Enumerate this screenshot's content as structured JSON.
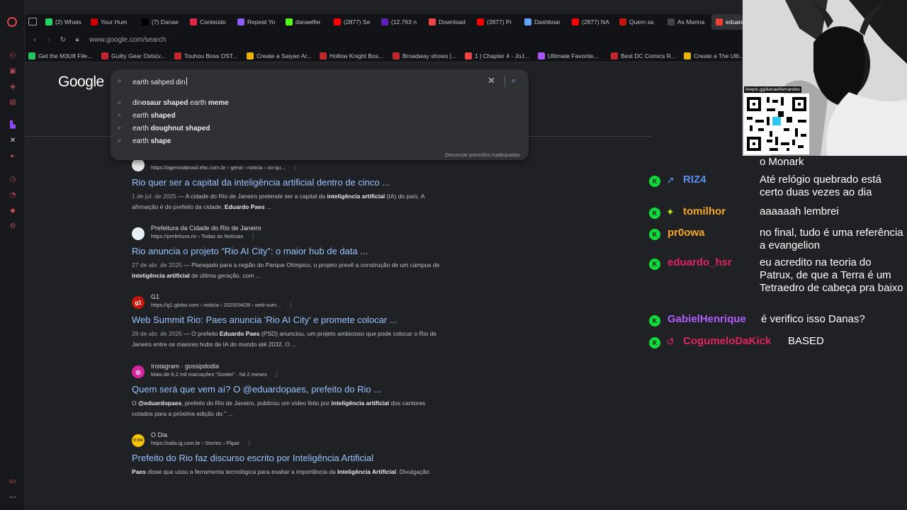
{
  "sidebar": {
    "icons": [
      "opera-icon",
      "history-icon",
      "bag-icon",
      "flow-icon",
      "youtube-music-icon",
      "twitch-icon",
      "x-icon",
      "youtube-icon",
      "history-clock-icon",
      "settings-gear-icon",
      "pin-icon",
      "more-icon"
    ],
    "bottom_label": "GX"
  },
  "tabs": [
    {
      "label": "(2) Whats",
      "color": "#25d366"
    },
    {
      "label": "Your Hum",
      "color": "#c00"
    },
    {
      "label": "(7) Danae",
      "color": "#000"
    },
    {
      "label": "Conteúdo",
      "color": "#e0244a"
    },
    {
      "label": "Repeat Yo",
      "color": "#8b5cf6"
    },
    {
      "label": "danaelfer",
      "color": "#53fc18"
    },
    {
      "label": "(2877) Se",
      "color": "#ff0000"
    },
    {
      "label": "(12.763 n",
      "color": "#5b21b6"
    },
    {
      "label": "Download",
      "color": "#ef4444"
    },
    {
      "label": "(2877) Pr",
      "color": "#ff0000"
    },
    {
      "label": "Dashboar",
      "color": "#60a5fa"
    },
    {
      "label": "(2877) NA",
      "color": "#ff0000"
    },
    {
      "label": "Quem sa",
      "color": "#c4170c"
    },
    {
      "label": "As Marina",
      "color": "#444"
    },
    {
      "label": "eduard",
      "color": "#ea4335"
    }
  ],
  "url": "www.google.com/search",
  "bookmarks": [
    {
      "label": "Get the M3U8 File...",
      "color": "#22c55e"
    },
    {
      "label": "Guilty Gear Osts(v...",
      "color": "#c1272d"
    },
    {
      "label": "Touhou Boss OST...",
      "color": "#c1272d"
    },
    {
      "label": "Create a Saiyan Ar...",
      "color": "#eab308"
    },
    {
      "label": "Hollow Knight Bos...",
      "color": "#c1272d"
    },
    {
      "label": "Broadway shows |...",
      "color": "#c1272d"
    },
    {
      "label": "1 | Chapter 4 - JoJ...",
      "color": "#ef4444"
    },
    {
      "label": "Ultimate Favorite...",
      "color": "#a855f7"
    },
    {
      "label": "Best DC Comics R...",
      "color": "#c1272d"
    },
    {
      "label": "Create a The Ulti...",
      "color": "#eab308"
    }
  ],
  "google": {
    "logo": "Google",
    "query": "earth sahped din",
    "suggestions": [
      {
        "plain1": "din",
        "bold1": "osaur shaped",
        "plain2": " earth ",
        "bold2": "meme"
      },
      {
        "plain1": "earth ",
        "bold1": "shaped",
        "plain2": "",
        "bold2": ""
      },
      {
        "plain1": "earth ",
        "bold1": "doughnut shaped",
        "plain2": "",
        "bold2": ""
      },
      {
        "plain1": "earth ",
        "bold1": "shape",
        "plain2": "",
        "bold2": ""
      }
    ],
    "report_label": "Denunciar previsões inadequadas"
  },
  "results": [
    {
      "site": "",
      "cite": "https://agenciabrasil.ebc.com.br › geral › noticia › rio-qu...",
      "favicon_color": "#e6e6e6",
      "favicon_text": "",
      "title": "Rio quer ser a capital da inteligência artificial dentro de cinco ...",
      "date": "1 de jul. de 2025",
      "snippet_parts": [
        " — A cidade do Rio de Janeiro pretende ser a capital da ",
        "inteligência artificial",
        " (IA) do país. A afirmação é do prefeito da cidade, ",
        "Eduardo Paes",
        " ..."
      ]
    },
    {
      "site": "Prefeitura da Cidade do Rio de Janeiro",
      "cite": "https://prefeitura.rio › Todas as Notícias",
      "favicon_color": "#e8eef8",
      "favicon_text": "",
      "title": "Rio anuncia o projeto “Rio AI City”: o maior hub de data ...",
      "date": "27 de abr. de 2025",
      "snippet_parts": [
        " — Planejado para a região do Parque Olímpico, o projeto prevê a construção de um campus de ",
        "inteligência artificial",
        " de última geração, com ...",
        "",
        ""
      ]
    },
    {
      "site": "G1",
      "cite": "https://g1.globo.com › noticia › 2025/04/28 › web-sum...",
      "favicon_color": "#c4170c",
      "favicon_text": "g1",
      "title": "Web Summit Rio: Paes anuncia 'Rio AI City' e promete colocar ...",
      "date": "28 de abr. de 2025",
      "snippet_parts": [
        " — O prefeito ",
        "Eduardo Paes",
        " (PSD) anunciou, um projeto ambicioso que pode colocar o Rio de Janeiro entre os maiores hubs de IA do mundo até 2032. O ...",
        "",
        ""
      ]
    },
    {
      "site": "Instagram · gossipdodia",
      "cite": "Mais de 6,2 mil marcações \"Gostei\" · há 2 meses",
      "favicon_color": "#d6249f",
      "favicon_text": "◎",
      "title": "Quem será que vem aí? O @eduardopaes, prefeito do Rio ...",
      "date": "",
      "snippet_parts": [
        "O ",
        "@eduardopaes",
        ", prefeito do Rio de Janeiro, publicou um vídeo feito por ",
        "inteligência artificial",
        " dos cantores cotados para a próxima edição do \" ..."
      ]
    },
    {
      "site": "O Dia",
      "cite": "https://odia.ig.com.br › Stories › Flipar",
      "favicon_color": "#f5c400",
      "favicon_text": "O DIA",
      "title": "Prefeito do Rio faz discurso escrito por Inteligência Artificial",
      "date": "",
      "snippet_parts": [
        "",
        "Paes",
        " disse que usou a ferramenta tecnológica para exaltar a importância da ",
        "Inteligência Artificial",
        ". Divulgação."
      ]
    }
  ],
  "overlay": {
    "qr_url": "livepix.gg/danaelfernandes"
  },
  "chat": {
    "partial_text": "o Monark",
    "messages": [
      {
        "user": "RIZ4",
        "user_color": "#5b8def",
        "icon": "↗",
        "icon_color": "#5b8def",
        "text": "Até relógio quebrado está certo duas vezes ao dia"
      },
      {
        "user": "tomilhor",
        "user_color": "#f5a623",
        "icon": "✦",
        "icon_color": "#b5e61d",
        "text": "aaaaaah lembrei"
      },
      {
        "user": "pr0owa",
        "user_color": "#f5a623",
        "icon": "",
        "icon_color": "",
        "text": "no final, tudo é uma referência a evangelion"
      },
      {
        "user": "eduardo_hsr",
        "user_color": "#e0245e",
        "icon": "",
        "icon_color": "",
        "text": "eu acredito na teoria do Patrux, de que a Terra é um Tetraedro de cabeça pra baixo"
      },
      {
        "user": "GabielHenrique",
        "user_color": "#b05cff",
        "icon": "",
        "icon_color": "",
        "text": "é verifico isso Danas?"
      },
      {
        "user": "CogumeloDaKick",
        "user_color": "#e0245e",
        "icon": "↺",
        "icon_color": "#e0245e",
        "text": "BASED"
      }
    ]
  }
}
